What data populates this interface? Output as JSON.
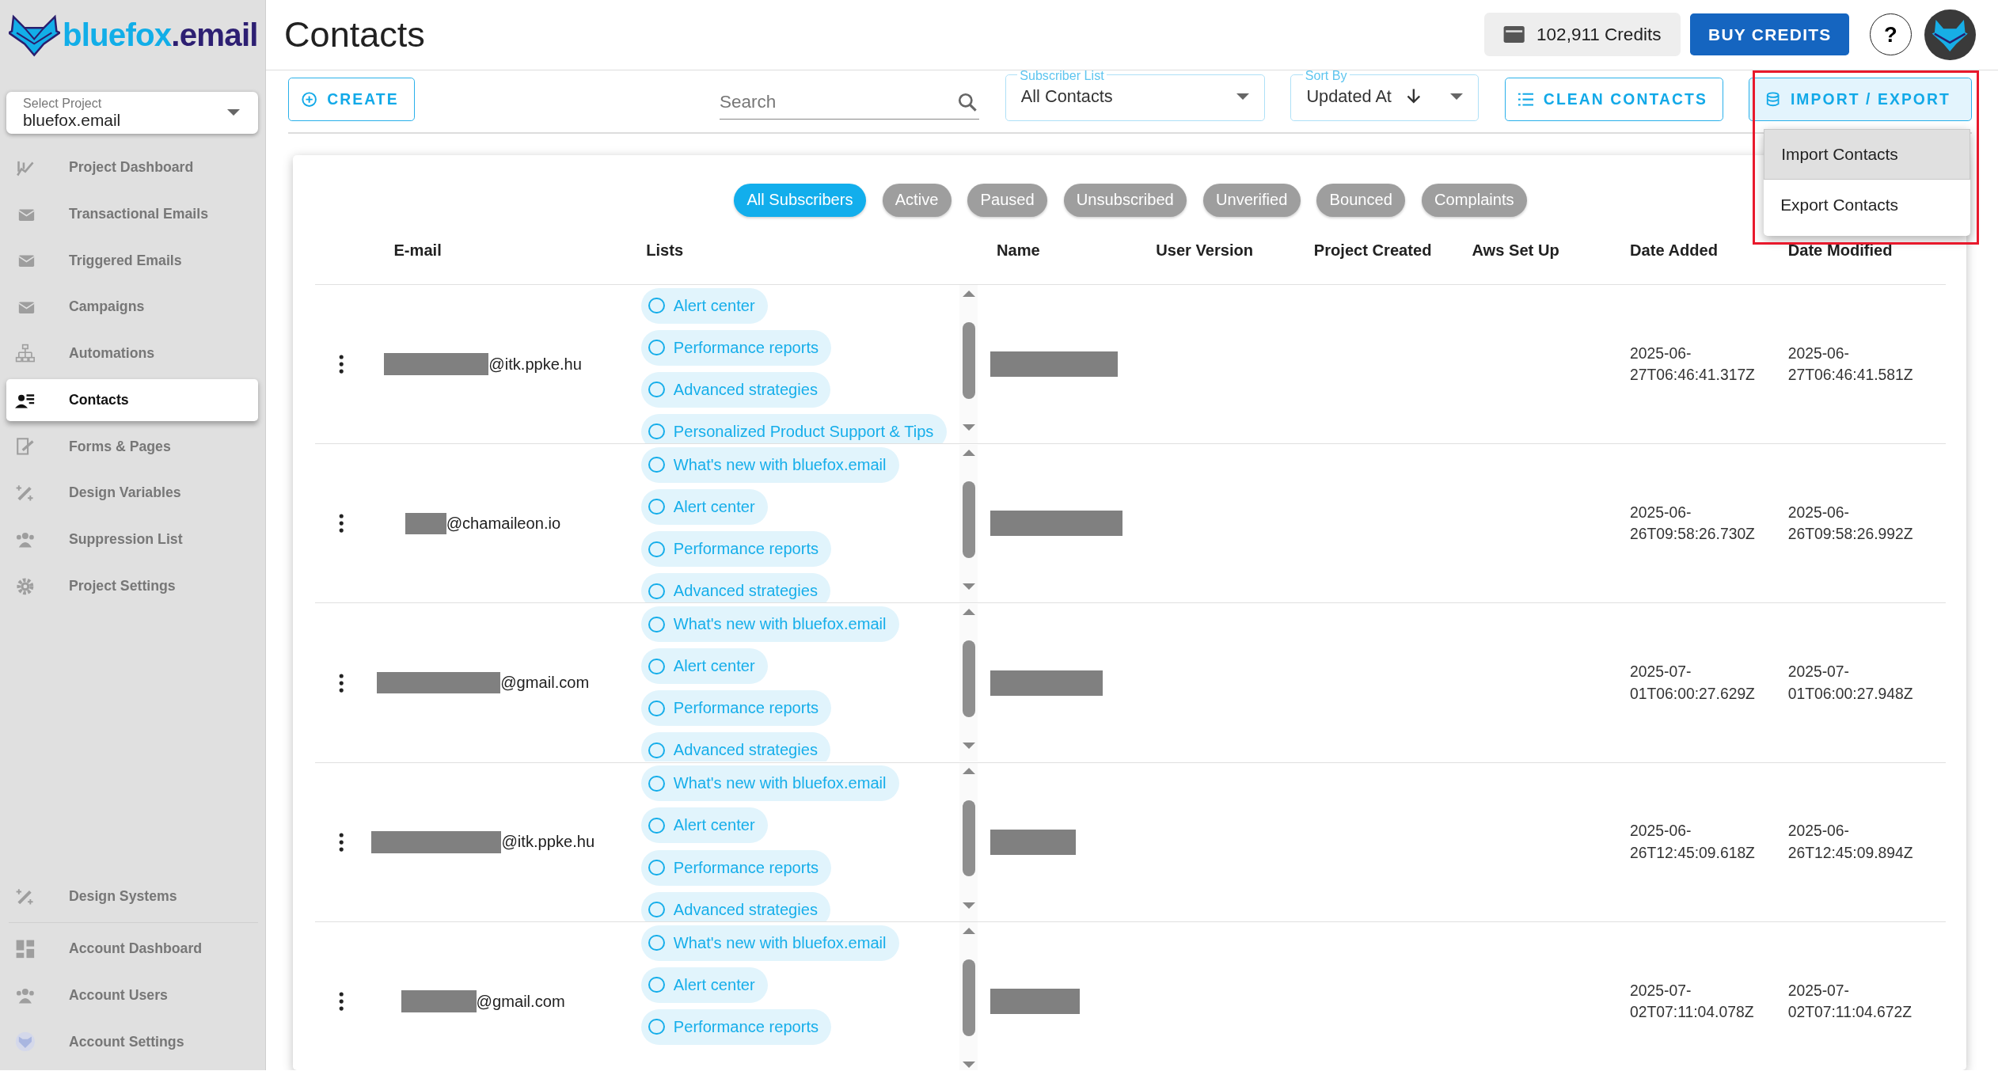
{
  "logo": {
    "name": "bluefox",
    "suffix": ".email"
  },
  "project_select": {
    "label": "Select Project",
    "value": "bluefox.email"
  },
  "nav": [
    {
      "label": "Project Dashboard",
      "selected": false
    },
    {
      "label": "Transactional Emails",
      "selected": false
    },
    {
      "label": "Triggered Emails",
      "selected": false
    },
    {
      "label": "Campaigns",
      "selected": false
    },
    {
      "label": "Automations",
      "selected": false
    },
    {
      "label": "Contacts",
      "selected": true
    },
    {
      "label": "Forms & Pages",
      "selected": false
    },
    {
      "label": "Design Variables",
      "selected": false
    },
    {
      "label": "Suppression List",
      "selected": false
    },
    {
      "label": "Project Settings",
      "selected": false
    }
  ],
  "nav_bottom": [
    {
      "label": "Design Systems",
      "selected": false
    },
    {
      "label": "Account Dashboard",
      "selected": false
    },
    {
      "label": "Account Users",
      "selected": false
    },
    {
      "label": "Account Settings",
      "selected": false
    }
  ],
  "page_title": "Contacts",
  "credits": "102,911 Credits",
  "buy_button": "BUY CREDITS",
  "help_button": "?",
  "toolbar": {
    "create": "CREATE",
    "search": {
      "placeholder": "Search"
    },
    "subscriber_list": {
      "label": "Subscriber List",
      "value": "All Contacts"
    },
    "sort_by": {
      "label": "Sort By",
      "value": "Updated At"
    },
    "clean": "CLEAN CONTACTS",
    "import_export": "IMPORT / EXPORT"
  },
  "menu": {
    "items": [
      {
        "label": "Import Contacts",
        "selected": true
      },
      {
        "label": "Export Contacts",
        "selected": false
      }
    ]
  },
  "filters": [
    {
      "label": "All Subscribers",
      "selected": true
    },
    {
      "label": "Active",
      "selected": false
    },
    {
      "label": "Paused",
      "selected": false
    },
    {
      "label": "Unsubscribed",
      "selected": false
    },
    {
      "label": "Unverified",
      "selected": false
    },
    {
      "label": "Bounced",
      "selected": false
    },
    {
      "label": "Complaints",
      "selected": false
    }
  ],
  "table": {
    "columns": [
      "E-mail",
      "Lists",
      "Name",
      "User Version",
      "Project Created",
      "Aws Set Up",
      "Date Added",
      "Date Modified"
    ],
    "rows": [
      {
        "email": "@itk.ppke.hu",
        "lists": [
          {
            "label": "Alert center",
            "checked": false
          },
          {
            "label": "Performance reports",
            "checked": false
          },
          {
            "label": "Advanced strategies",
            "checked": false
          },
          {
            "label": "Personalized Product Support & Tips",
            "checked": false
          }
        ],
        "date_added": "2025-06-27T06:46:41.317Z",
        "date_modified": "2025-06-27T06:46:41.581Z"
      },
      {
        "email": "@chamaileon.io",
        "lists": [
          {
            "label": "What's new with bluefox.email",
            "checked": false
          },
          {
            "label": "Alert center",
            "checked": false
          },
          {
            "label": "Performance reports",
            "checked": false
          },
          {
            "label": "Advanced strategies",
            "checked": false
          }
        ],
        "date_added": "2025-06-26T09:58:26.730Z",
        "date_modified": "2025-06-26T09:58:26.992Z"
      },
      {
        "email": "@gmail.com",
        "lists": [
          {
            "label": "What's new with bluefox.email",
            "checked": false
          },
          {
            "label": "Alert center",
            "checked": false
          },
          {
            "label": "Performance reports",
            "checked": false
          },
          {
            "label": "Advanced strategies",
            "checked": false
          }
        ],
        "date_added": "2025-07-01T06:00:27.629Z",
        "date_modified": "2025-07-01T06:00:27.948Z"
      },
      {
        "email": "@itk.ppke.hu",
        "lists": [
          {
            "label": "What's new with bluefox.email",
            "checked": false
          },
          {
            "label": "Alert center",
            "checked": false
          },
          {
            "label": "Performance reports",
            "checked": false
          },
          {
            "label": "Advanced strategies",
            "checked": false
          }
        ],
        "date_added": "2025-06-26T12:45:09.618Z",
        "date_modified": "2025-06-26T12:45:09.894Z"
      },
      {
        "email": "@gmail.com",
        "lists": [
          {
            "label": "What's new with bluefox.email",
            "checked": false
          },
          {
            "label": "Alert center",
            "checked": false
          },
          {
            "label": "Performance reports",
            "checked": false
          }
        ],
        "date_added": "2025-07-02T07:11:04.078Z",
        "date_modified": "2025-07-02T07:11:04.672Z"
      }
    ]
  }
}
